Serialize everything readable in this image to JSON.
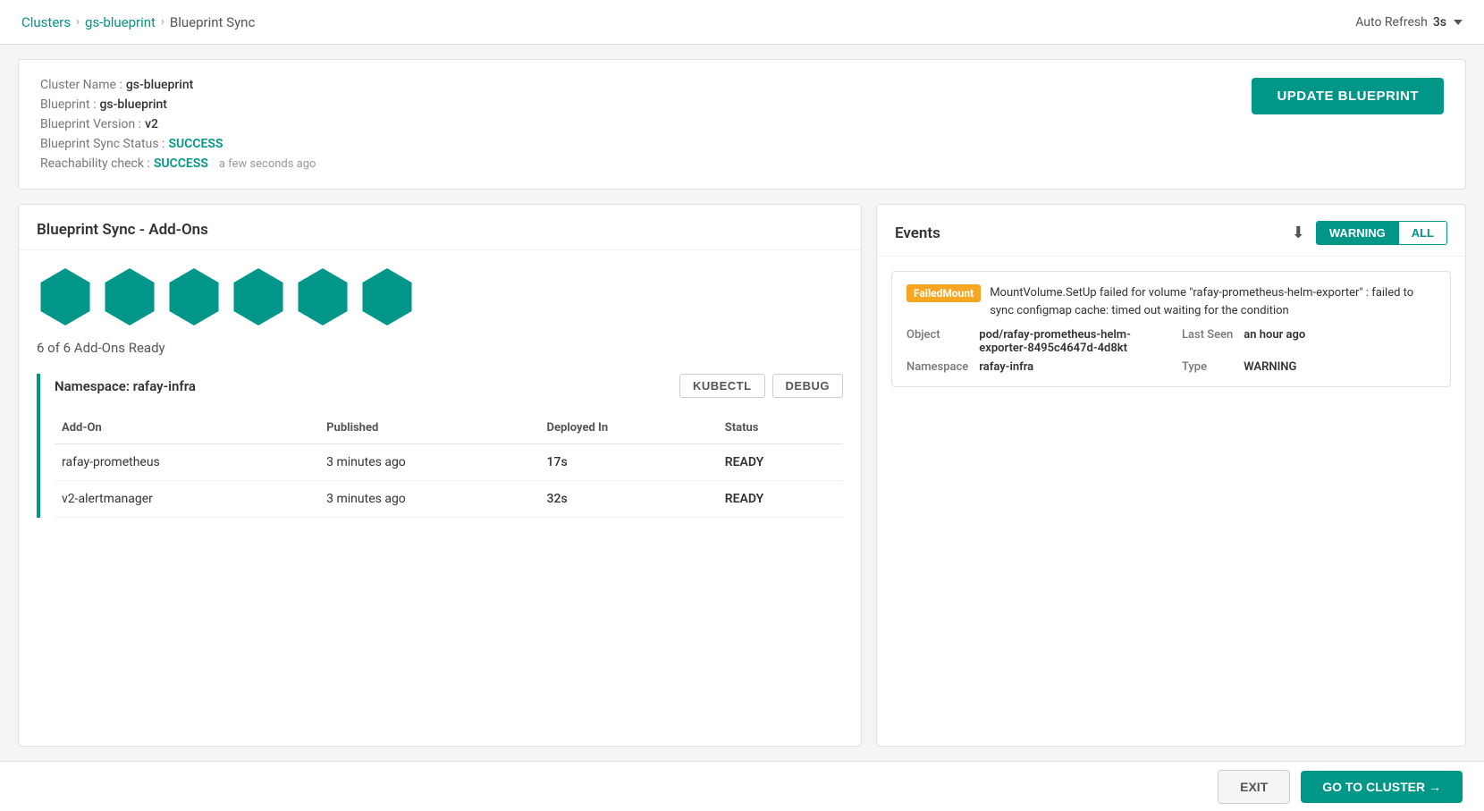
{
  "topbar": {
    "breadcrumb": {
      "clusters_label": "Clusters",
      "sep1": "›",
      "blueprint_label": "gs-blueprint",
      "sep2": "›",
      "current_label": "Blueprint Sync"
    },
    "auto_refresh_label": "Auto Refresh",
    "auto_refresh_value": "3s",
    "chevron": "▾"
  },
  "info_card": {
    "cluster_name_label": "Cluster Name :",
    "cluster_name_value": "gs-blueprint",
    "blueprint_label": "Blueprint :",
    "blueprint_value": "gs-blueprint",
    "blueprint_version_label": "Blueprint Version :",
    "blueprint_version_value": "v2",
    "blueprint_sync_status_label": "Blueprint Sync Status :",
    "blueprint_sync_status_value": "SUCCESS",
    "reachability_check_label": "Reachability check :",
    "reachability_check_value": "SUCCESS",
    "reachability_time": "a few seconds ago",
    "update_button_label": "UPDATE BLUEPRINT"
  },
  "left_panel": {
    "title": "Blueprint Sync - Add-Ons",
    "hexagon_count": 6,
    "addons_ready_text": "6 of 6 Add-Ons Ready",
    "namespace_title": "Namespace: rafay-infra",
    "kubectl_label": "KUBECTL",
    "debug_label": "DEBUG",
    "table": {
      "headers": [
        "Add-On",
        "Published",
        "Deployed In",
        "Status"
      ],
      "rows": [
        {
          "addon": "rafay-prometheus",
          "published": "3 minutes ago",
          "deployed_in": "17s",
          "status": "READY"
        },
        {
          "addon": "v2-alertmanager",
          "published": "3 minutes ago",
          "deployed_in": "32s",
          "status": "READY"
        }
      ]
    }
  },
  "right_panel": {
    "title": "Events",
    "filter_warning_label": "WARNING",
    "filter_all_label": "ALL",
    "active_filter": "WARNING",
    "events": [
      {
        "badge": "FailedMount",
        "message": "MountVolume.SetUp failed for volume \"rafay-prometheus-helm-exporter\" : failed to sync configmap cache: timed out waiting for the condition",
        "object_label": "Object",
        "object_value": "pod/rafay-prometheus-helm-exporter-8495c4647d-4d8kt",
        "namespace_label": "Namespace",
        "namespace_value": "rafay-infra",
        "last_seen_label": "Last Seen",
        "last_seen_value": "an hour ago",
        "type_label": "Type",
        "type_value": "WARNING"
      }
    ]
  },
  "bottom_bar": {
    "exit_label": "EXIT",
    "goto_label": "GO TO CLUSTER →"
  }
}
